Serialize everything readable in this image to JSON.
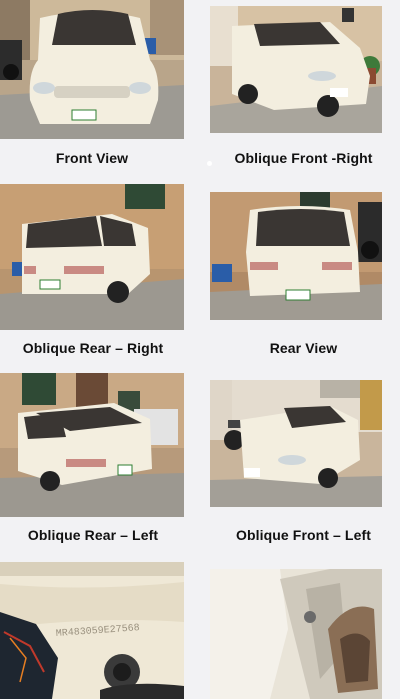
{
  "gallery": {
    "captions": [
      "Front View",
      "Oblique Front -Right",
      "Oblique Rear – Right",
      "Rear View",
      "Oblique Rear – Left",
      "Oblique Front – Left"
    ],
    "photo_subjects": [
      "front-view-photo",
      "oblique-front-right-photo",
      "oblique-rear-right-photo",
      "rear-view-photo",
      "oblique-rear-left-photo",
      "oblique-front-left-photo",
      "chassis-number-photo",
      "engine-bay-photo"
    ],
    "chassis_number_text": "MR483059E27568"
  },
  "colors": {
    "page_background": "#f2f2f4",
    "car_body": "#f3eedf",
    "caption_text": "#111111"
  }
}
